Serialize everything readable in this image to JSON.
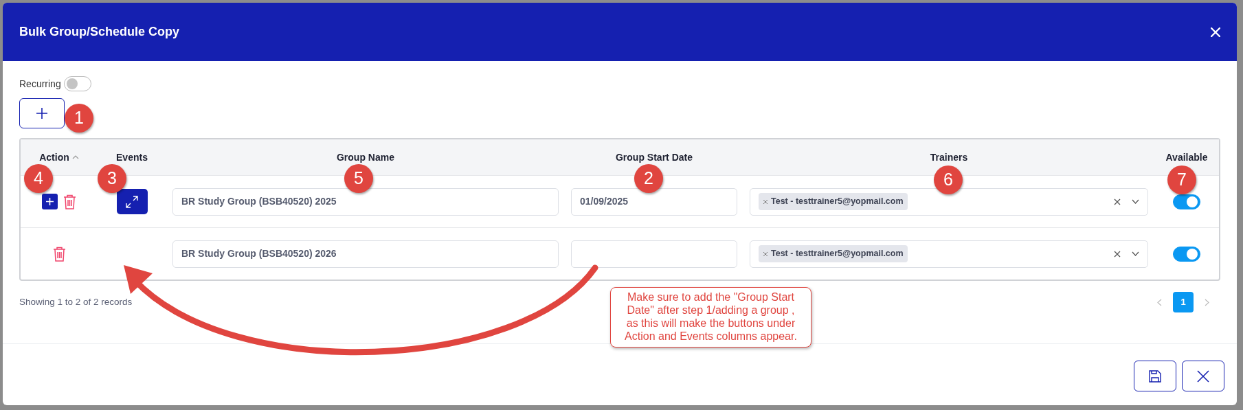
{
  "modal": {
    "title": "Bulk Group/Schedule Copy"
  },
  "recurring": {
    "label": "Recurring",
    "on": false
  },
  "table": {
    "columns": [
      {
        "label": "Action",
        "sorted": true
      },
      {
        "label": "Events",
        "sorted": false
      },
      {
        "label": "Group Name",
        "sorted": false
      },
      {
        "label": "Group Start Date",
        "sorted": false
      },
      {
        "label": "Trainers",
        "sorted": false
      },
      {
        "label": "Available",
        "sorted": false
      }
    ],
    "rows": [
      {
        "show_add": true,
        "show_events": true,
        "group_name": "BR Study Group (BSB40520) 2025",
        "start_date": "01/09/2025",
        "trainers": [
          {
            "label": "Test - testtrainer5@yopmail.com"
          }
        ],
        "available": true
      },
      {
        "show_add": false,
        "show_events": false,
        "group_name": "BR Study Group (BSB40520) 2026",
        "trainers": [
          {
            "label": "Test - testtrainer5@yopmail.com"
          }
        ],
        "available": true
      }
    ]
  },
  "summary": "Showing 1 to 2 of 2 records",
  "pagination": [
    {
      "label": "1",
      "selected": true
    }
  ],
  "annotations": {
    "markers": [
      {
        "label": "1"
      },
      {
        "label": "4"
      },
      {
        "label": "3"
      },
      {
        "label": "5"
      },
      {
        "label": "2"
      },
      {
        "label": "6"
      },
      {
        "label": "7"
      }
    ],
    "callout": "Make sure to add the \"Group Start Date\" after step 1/adding a group , as this will make the buttons under Action and Events columns appear."
  }
}
